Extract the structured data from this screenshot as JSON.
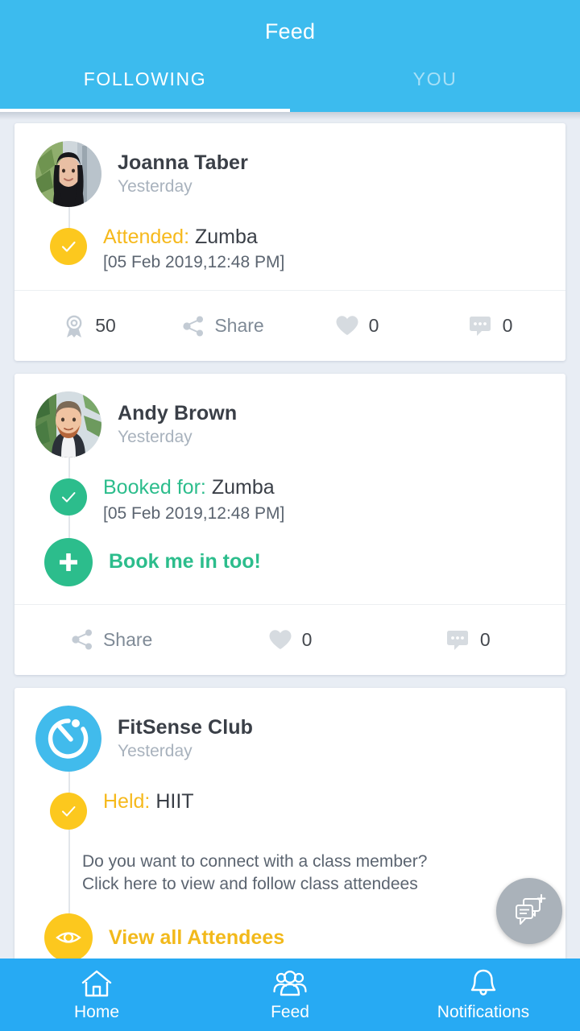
{
  "header": {
    "title": "Feed",
    "tabs": [
      {
        "label": "FOLLOWING",
        "active": true
      },
      {
        "label": "YOU",
        "active": false
      }
    ]
  },
  "colors": {
    "header_blue": "#3cbbee",
    "nav_blue": "#27aaf3",
    "yellow": "#fcc81e",
    "yellow_text": "#f6b91c",
    "green": "#2cbd8c",
    "page_background": "#e8edf4",
    "card_background": "#ffffff",
    "muted_text": "#a8b2bd",
    "body_text": "#3a3f47",
    "fab_gray": "#aab2ba"
  },
  "feed": {
    "posts": [
      {
        "author": "Joanna Taber",
        "time": "Yesterday",
        "avatar_type": "photo-woman",
        "status_label": "Attended:",
        "status_value": "Zumba",
        "status_color": "yellow",
        "timestamp": "[05 Feb 2019,12:48 PM]",
        "cta": null,
        "info": null,
        "actions": {
          "attendees_count": "50",
          "share_label": "Share",
          "likes_count": "0",
          "comments_count": "0"
        }
      },
      {
        "author": "Andy Brown",
        "time": "Yesterday",
        "avatar_type": "photo-man",
        "status_label": "Booked for:",
        "status_value": "Zumba",
        "status_color": "green",
        "timestamp": "[05 Feb 2019,12:48 PM]",
        "cta": {
          "label": "Book me in too!",
          "icon": "plus-icon",
          "color": "green"
        },
        "info": null,
        "actions": {
          "attendees_count": null,
          "share_label": "Share",
          "likes_count": "0",
          "comments_count": "0"
        }
      },
      {
        "author": "FitSense Club",
        "time": "Yesterday",
        "avatar_type": "logo-stopwatch",
        "status_label": "Held:",
        "status_value": "HIIT",
        "status_color": "yellow",
        "timestamp": null,
        "cta": {
          "label": "View all Attendees",
          "icon": "eye-icon",
          "color": "yellow"
        },
        "info_line1": "Do you want to connect with a class member?",
        "info_line2": "Click here to view and follow class attendees",
        "actions": null
      }
    ]
  },
  "fab": {
    "icon": "chat-plus-icon"
  },
  "bottom_nav": {
    "items": [
      {
        "label": "Home",
        "icon": "home-icon"
      },
      {
        "label": "Feed",
        "icon": "people-icon"
      },
      {
        "label": "Notifications",
        "icon": "bell-icon"
      }
    ]
  }
}
